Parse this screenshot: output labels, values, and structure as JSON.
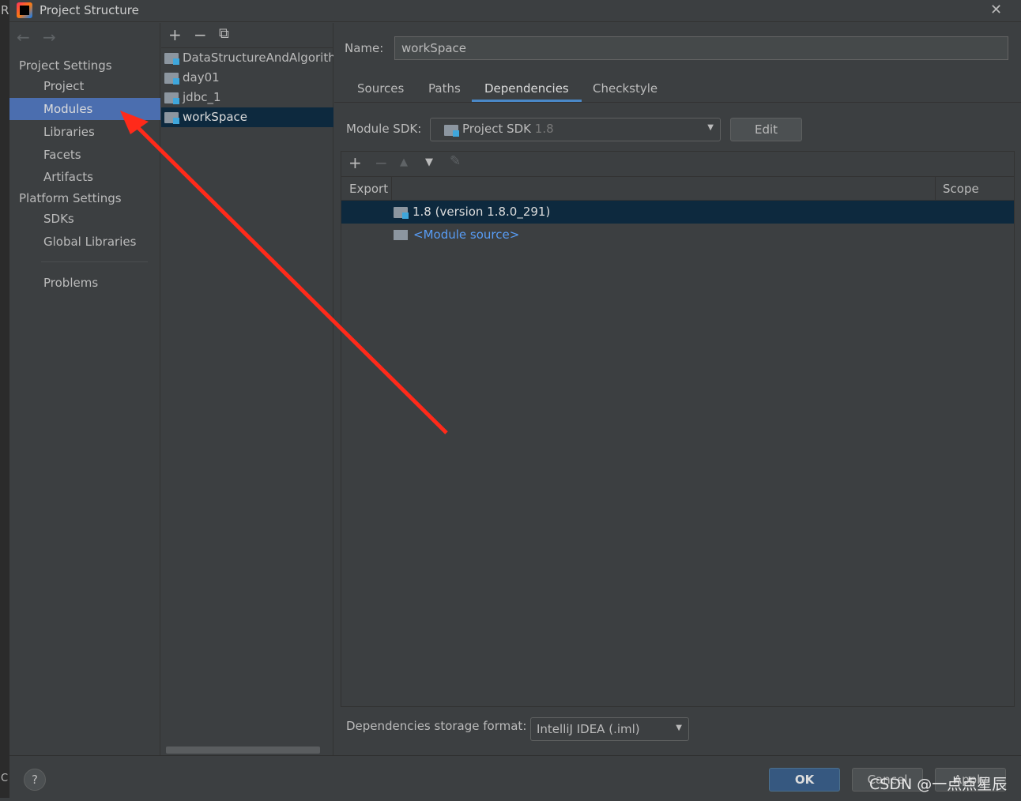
{
  "window": {
    "title": "Project Structure",
    "close": "✕",
    "ide_letter_top": "R",
    "ide_letter_bottom": "C"
  },
  "sidebar": {
    "back": "←",
    "forward": "→",
    "items": [
      {
        "label": "Project Settings",
        "type": "header"
      },
      {
        "label": "Project"
      },
      {
        "label": "Modules",
        "selected": true
      },
      {
        "label": "Libraries"
      },
      {
        "label": "Facets"
      },
      {
        "label": "Artifacts"
      },
      {
        "label": "Platform Settings",
        "type": "header"
      },
      {
        "label": "SDKs"
      },
      {
        "label": "Global Libraries"
      },
      {
        "label": "Problems"
      }
    ]
  },
  "modules": {
    "add": "+",
    "remove": "−",
    "copy": "⧉",
    "items": [
      "DataStructureAndAlgorith",
      "day01",
      "jdbc_1",
      "workSpace"
    ],
    "selected": "workSpace"
  },
  "detail": {
    "name_label": "Name:",
    "name_value": "workSpace",
    "tabs": [
      "Sources",
      "Paths",
      "Dependencies",
      "Checkstyle"
    ],
    "active_tab": "Dependencies",
    "sdk_label": "Module SDK:",
    "sdk_value": "Project SDK",
    "sdk_version": "1.8",
    "edit": "Edit",
    "toolbar": {
      "add": "+",
      "remove": "−",
      "up": "▲",
      "down": "▼",
      "edit": "✎"
    },
    "columns": [
      "Export",
      "Scope"
    ],
    "rows": [
      {
        "label": "1.8 (version 1.8.0_291)",
        "selected": true
      },
      {
        "label": "<Module source>",
        "link": true
      }
    ],
    "storage_label": "Dependencies storage format:",
    "storage_value": "IntelliJ IDEA (.iml)"
  },
  "footer": {
    "help": "?",
    "ok": "OK",
    "cancel": "Cancel",
    "apply": "Apply",
    "watermark": "CSDN @一点点星辰"
  },
  "colors": {
    "selection": "#4b6eaf",
    "row_selection": "#0d293e",
    "link": "#589df6",
    "ok": "#365880",
    "arrow": "#ff2a1a"
  }
}
